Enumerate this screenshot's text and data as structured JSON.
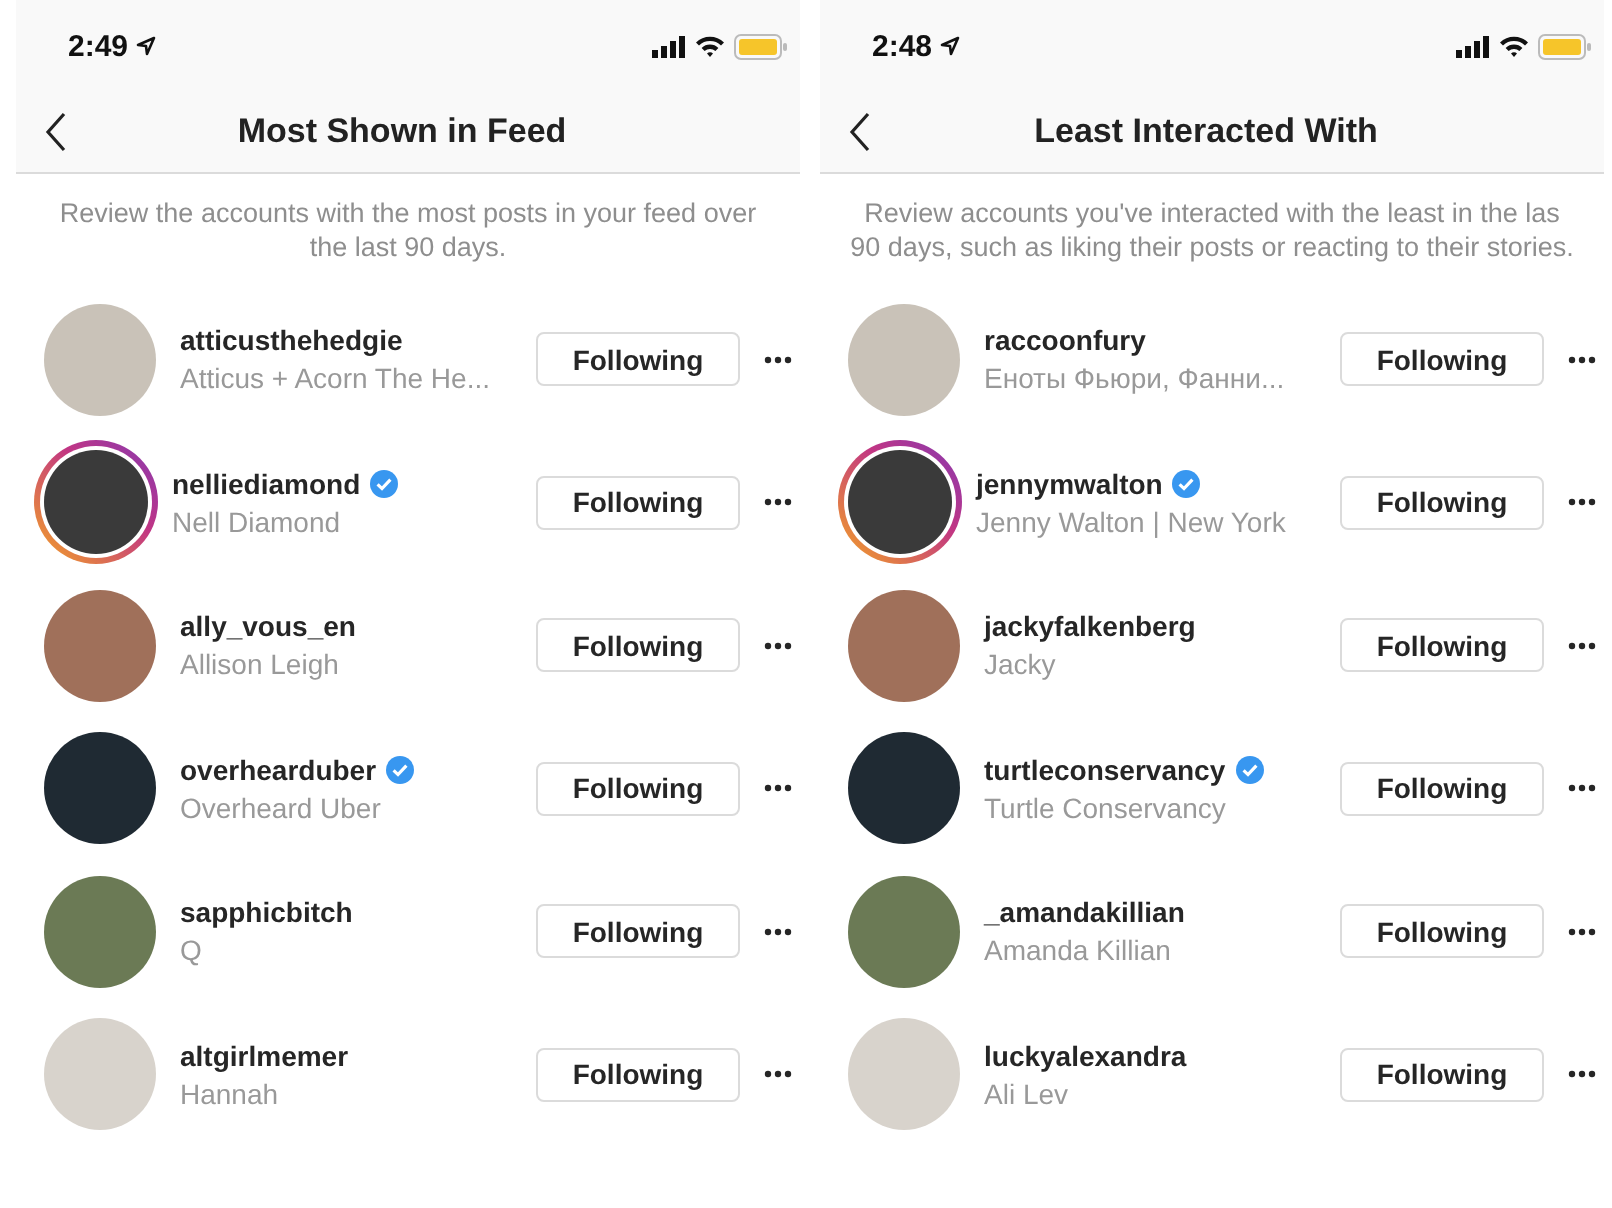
{
  "screens": [
    {
      "status_bar": {
        "time": "2:49"
      },
      "nav": {
        "title": "Most Shown in Feed"
      },
      "description": "Review the accounts with the most posts in your feed over the last 90 days.",
      "accounts": [
        {
          "username": "atticusthehedgie",
          "name": "Atticus + Acorn The He...",
          "verified": false,
          "story_ring": false,
          "button": "Following"
        },
        {
          "username": "nelliediamond",
          "name": "Nell Diamond",
          "verified": true,
          "story_ring": true,
          "button": "Following"
        },
        {
          "username": "ally_vous_en",
          "name": "Allison Leigh",
          "verified": false,
          "story_ring": false,
          "button": "Following"
        },
        {
          "username": "overhearduber",
          "name": "Overheard Uber",
          "verified": true,
          "story_ring": false,
          "button": "Following"
        },
        {
          "username": "sapphicbitch",
          "name": "Q",
          "verified": false,
          "story_ring": false,
          "button": "Following"
        },
        {
          "username": "altgirlmemer",
          "name": "Hannah",
          "verified": false,
          "story_ring": false,
          "button": "Following"
        }
      ]
    },
    {
      "status_bar": {
        "time": "2:48"
      },
      "nav": {
        "title": "Least Interacted With"
      },
      "description": "Review accounts you've interacted with the least in the las 90 days, such as liking their posts or reacting to their stories.",
      "accounts": [
        {
          "username": "raccoonfury",
          "name": "Еноты Фьюри, Фанни...",
          "verified": false,
          "story_ring": false,
          "button": "Following"
        },
        {
          "username": "jennymwalton",
          "name": "Jenny Walton | New York",
          "verified": true,
          "story_ring": true,
          "button": "Following"
        },
        {
          "username": "jackyfalkenberg",
          "name": "Jacky",
          "verified": false,
          "story_ring": false,
          "button": "Following"
        },
        {
          "username": "turtleconservancy",
          "name": "Turtle Conservancy",
          "verified": true,
          "story_ring": false,
          "button": "Following"
        },
        {
          "username": "_amandakillian",
          "name": "Amanda Killian",
          "verified": false,
          "story_ring": false,
          "button": "Following"
        },
        {
          "username": "luckyalexandra",
          "name": "Ali Lev",
          "verified": false,
          "story_ring": false,
          "button": "Following"
        }
      ]
    }
  ]
}
